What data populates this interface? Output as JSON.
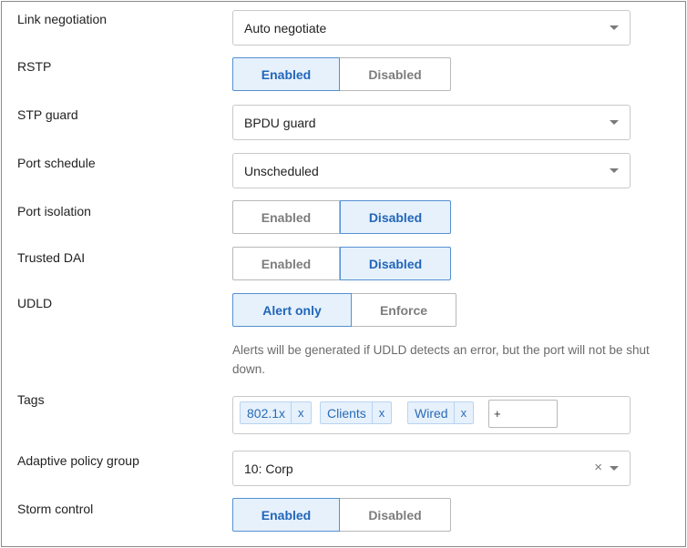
{
  "link_negotiation": {
    "label": "Link negotiation",
    "value": "Auto negotiate"
  },
  "rstp": {
    "label": "RSTP",
    "options": [
      "Enabled",
      "Disabled"
    ],
    "selected": "Enabled"
  },
  "stp_guard": {
    "label": "STP guard",
    "value": "BPDU guard"
  },
  "port_schedule": {
    "label": "Port schedule",
    "value": "Unscheduled"
  },
  "port_isolation": {
    "label": "Port isolation",
    "options": [
      "Enabled",
      "Disabled"
    ],
    "selected": "Disabled"
  },
  "trusted_dai": {
    "label": "Trusted DAI",
    "options": [
      "Enabled",
      "Disabled"
    ],
    "selected": "Disabled"
  },
  "udld": {
    "label": "UDLD",
    "options": [
      "Alert only",
      "Enforce"
    ],
    "selected": "Alert only",
    "help": "Alerts will be generated if UDLD detects an error, but the port will not be shut down."
  },
  "tags": {
    "label": "Tags",
    "items": [
      {
        "text": "802.1x",
        "remove": "x"
      },
      {
        "text": "Clients",
        "remove": "x"
      },
      {
        "text": "Wired",
        "remove": "x"
      }
    ],
    "input_placeholder": "+"
  },
  "adaptive_policy_group": {
    "label": "Adaptive policy group",
    "value": "10: Corp",
    "clear": "×"
  },
  "storm_control": {
    "label": "Storm control",
    "options": [
      "Enabled",
      "Disabled"
    ],
    "selected": "Enabled"
  },
  "colors": {
    "accent": "#2266b9",
    "active_bg": "#e6f1fc",
    "border": "#c9c9c9"
  },
  "icons": {
    "select_caret": "chevron-down-icon",
    "clear": "clear-icon",
    "tag_remove": "close-icon"
  }
}
